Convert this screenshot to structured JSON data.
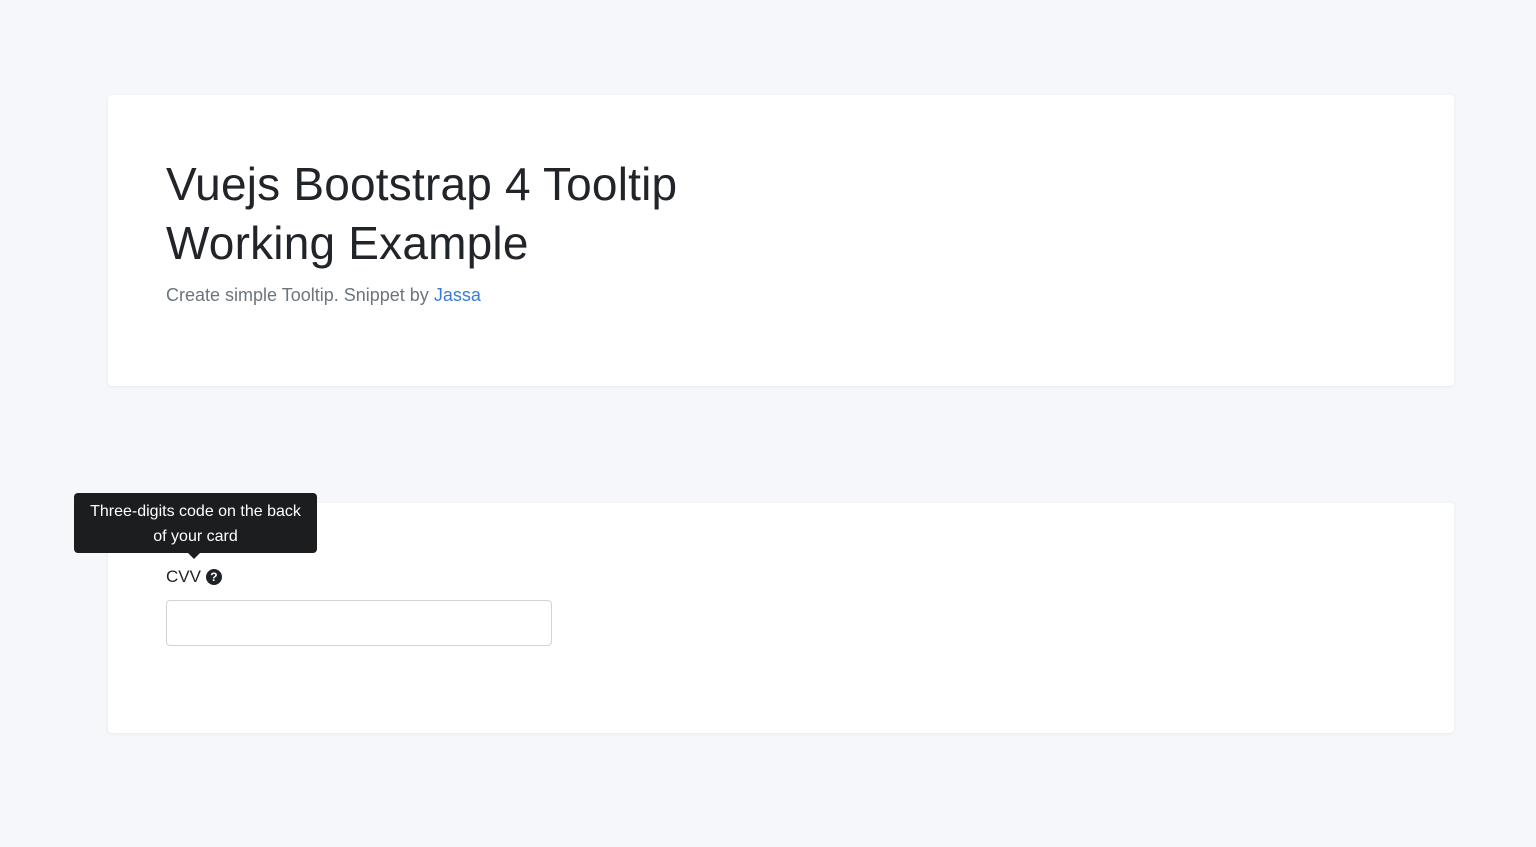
{
  "hero": {
    "title": "Vuejs Bootstrap 4 Tooltip Working Example",
    "subtitle_text": "Create simple Tooltip. Snippet by ",
    "author_link": "Jassa"
  },
  "form": {
    "cvv_label": "CVV",
    "help_icon": "question-circle-icon",
    "help_glyph": "?",
    "cvv_value": ""
  },
  "tooltip": {
    "text": "Three-digits code on the back of your card"
  },
  "colors": {
    "background": "#f5f7fa",
    "link": "#3a7bd5",
    "tooltip_bg": "#1c1d1f"
  }
}
